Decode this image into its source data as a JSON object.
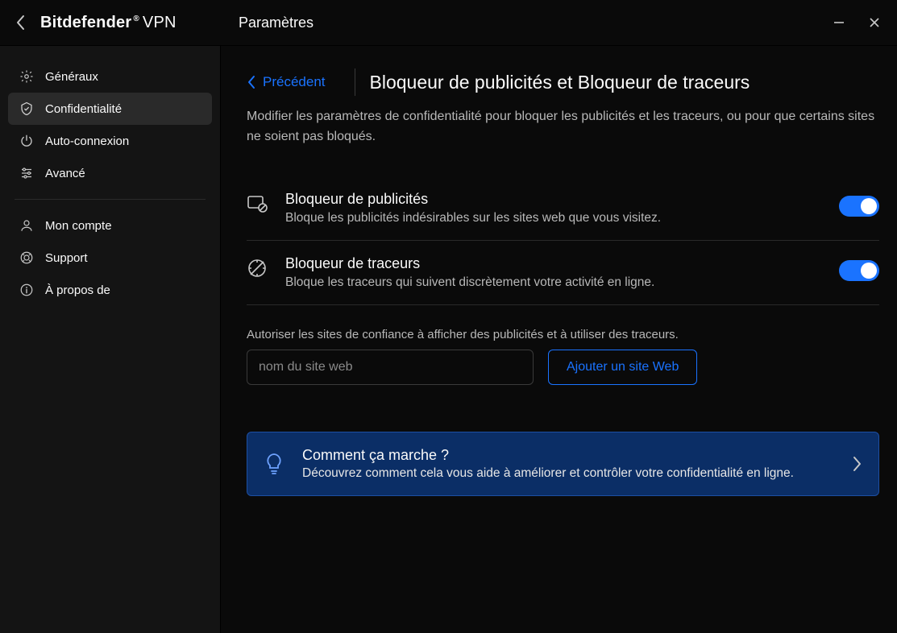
{
  "app": {
    "brand_main": "Bitdefender",
    "brand_suffix": "VPN",
    "titlebar_title": "Paramètres"
  },
  "sidebar": {
    "items": [
      {
        "id": "general",
        "label": "Généraux"
      },
      {
        "id": "privacy",
        "label": "Confidentialité"
      },
      {
        "id": "autoconn",
        "label": "Auto-connexion"
      },
      {
        "id": "advanced",
        "label": "Avancé"
      }
    ],
    "items2": [
      {
        "id": "account",
        "label": "Mon compte"
      },
      {
        "id": "support",
        "label": "Support"
      },
      {
        "id": "about",
        "label": "À propos de"
      }
    ]
  },
  "page": {
    "back_label": "Précédent",
    "title": "Bloqueur de publicités et Bloqueur de traceurs",
    "lead": "Modifier les paramètres de confidentialité pour bloquer les publicités et les traceurs, ou pour que certains sites ne soient pas bloqués."
  },
  "features": {
    "adblock": {
      "title": "Bloqueur de publicités",
      "desc": "Bloque les publicités indésirables sur les sites web que vous visitez.",
      "enabled": true
    },
    "tracker": {
      "title": "Bloqueur de traceurs",
      "desc": "Bloque les traceurs qui suivent discrètement votre activité en ligne.",
      "enabled": true
    }
  },
  "whitelist": {
    "label": "Autoriser les sites de confiance à afficher des publicités et à utiliser des traceurs.",
    "placeholder": "nom du site web",
    "value": "",
    "button": "Ajouter un site Web"
  },
  "info": {
    "title": "Comment ça marche ?",
    "desc": "Découvrez comment cela vous aide à améliorer et contrôler votre confidentialité en ligne."
  }
}
